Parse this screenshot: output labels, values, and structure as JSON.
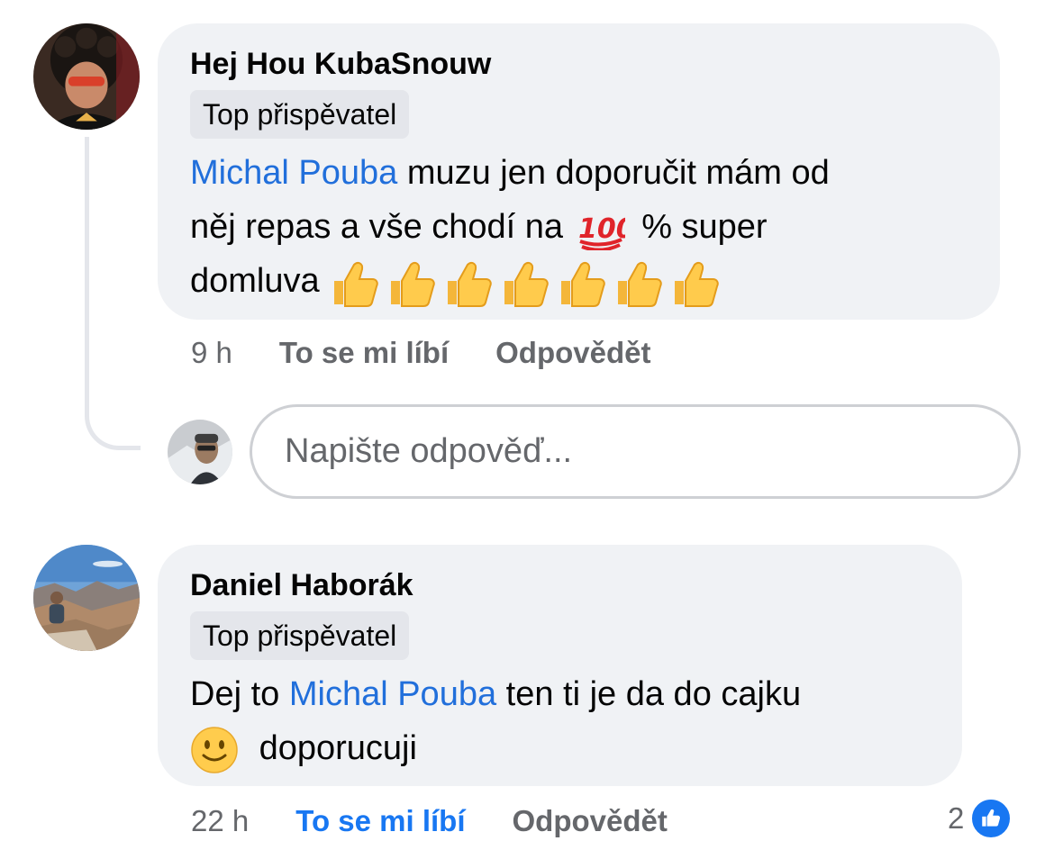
{
  "comments": [
    {
      "author": "Hej Hou KubaSnouw",
      "badge": "Top přispěvatel",
      "mention": "Michal Pouba",
      "text_after_mention": "muzu jen doporučit mám od",
      "line2": "něj repas a vše chodí na",
      "line2_end": "% super",
      "line3": "domluva",
      "emojis": [
        "thumbs-up",
        "thumbs-up",
        "thumbs-up",
        "thumbs-up",
        "thumbs-up",
        "thumbs-up",
        "thumbs-up",
        "hundred-points"
      ],
      "time": "9 h",
      "like_label": "To se mi líbí",
      "reply_label": "Odpovědět"
    },
    {
      "author": "Daniel Haborák",
      "badge": "Top přispěvatel",
      "text_before_mention": "Dej to",
      "mention": "Michal Pouba",
      "text_after_mention": "ten ti je da do cajku",
      "line2": "doporucuji",
      "emojis": [
        "slightly-smiling-face"
      ],
      "time": "22 h",
      "like_label": "To se mi líbí",
      "reply_label": "Odpovědět",
      "liked": true,
      "reaction_count": "2",
      "reaction_icon": "like-icon"
    }
  ],
  "reply_input": {
    "placeholder": "Napište odpověď..."
  },
  "colors": {
    "mention": "#216fdb",
    "like_active": "#1877f2",
    "bubble": "#f0f2f5",
    "muted": "#65676b"
  }
}
